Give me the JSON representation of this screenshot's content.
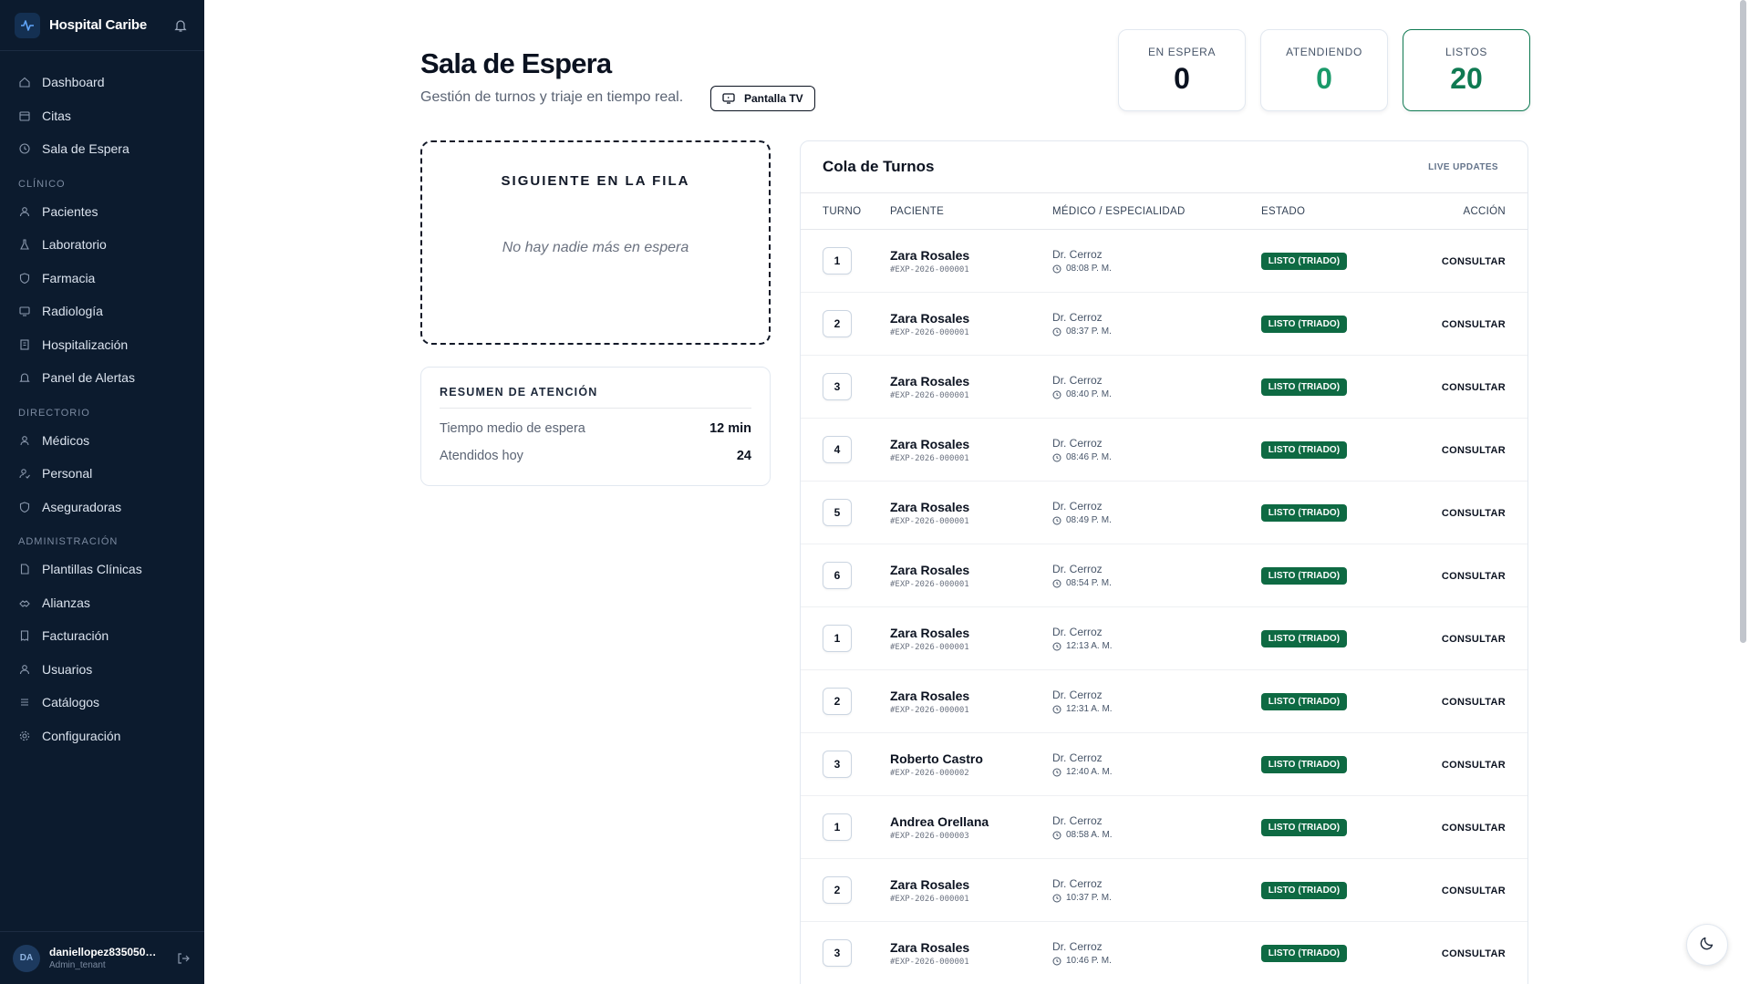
{
  "brand": {
    "name": "Hospital Caribe"
  },
  "nav": {
    "main": [
      {
        "label": "Dashboard",
        "icon": "home-icon"
      },
      {
        "label": "Citas",
        "icon": "calendar-icon"
      },
      {
        "label": "Sala de Espera",
        "icon": "clock-icon"
      }
    ],
    "sections": [
      {
        "title": "CLÍNICO",
        "items": [
          {
            "label": "Pacientes",
            "icon": "users-icon"
          },
          {
            "label": "Laboratorio",
            "icon": "flask-icon"
          },
          {
            "label": "Farmacia",
            "icon": "shield-icon"
          },
          {
            "label": "Radiología",
            "icon": "monitor-icon"
          },
          {
            "label": "Hospitalización",
            "icon": "building-icon"
          },
          {
            "label": "Panel de Alertas",
            "icon": "bell-icon"
          }
        ]
      },
      {
        "title": "DIRECTORIO",
        "items": [
          {
            "label": "Médicos",
            "icon": "user-icon"
          },
          {
            "label": "Personal",
            "icon": "user-check-icon"
          },
          {
            "label": "Aseguradoras",
            "icon": "shield-icon"
          }
        ]
      },
      {
        "title": "ADMINISTRACIÓN",
        "items": [
          {
            "label": "Plantillas Clínicas",
            "icon": "file-icon"
          },
          {
            "label": "Alianzas",
            "icon": "handshake-icon"
          },
          {
            "label": "Facturación",
            "icon": "receipt-icon"
          },
          {
            "label": "Usuarios",
            "icon": "users-icon"
          },
          {
            "label": "Catálogos",
            "icon": "list-icon"
          },
          {
            "label": "Configuración",
            "icon": "gear-icon"
          }
        ]
      }
    ]
  },
  "user": {
    "initials": "DA",
    "name": "daniellopez835050…",
    "role": "Admin_tenant"
  },
  "header": {
    "title": "Sala de Espera",
    "subtitle": "Gestión de turnos y triaje en tiempo real.",
    "tv_button": "Pantalla TV"
  },
  "stats": [
    {
      "label": "EN ESPERA",
      "value": "0",
      "color": "#0b1220"
    },
    {
      "label": "ATENDIENDO",
      "value": "0",
      "color": "#1a9a6a"
    },
    {
      "label": "LISTOS",
      "value": "20",
      "color": "#0f7a52"
    }
  ],
  "next": {
    "title": "SIGUIENTE EN LA FILA",
    "empty": "No hay nadie más en espera"
  },
  "summary": {
    "title": "RESUMEN DE ATENCIÓN",
    "rows": [
      {
        "label": "Tiempo medio de espera",
        "value": "12 min"
      },
      {
        "label": "Atendidos hoy",
        "value": "24"
      }
    ]
  },
  "queue": {
    "title": "Cola de Turnos",
    "live": "LIVE UPDATES",
    "columns": {
      "turno": "TURNO",
      "paciente": "PACIENTE",
      "medico": "MÉDICO / ESPECIALIDAD",
      "estado": "ESTADO",
      "accion": "ACCIÓN"
    },
    "rows": [
      {
        "turno": "1",
        "name": "Zara Rosales",
        "exp": "#EXP-2026-000001",
        "doctor": "Dr. Cerroz",
        "time": "08:08 P. M.",
        "status": "LISTO (TRIADO)",
        "action": "CONSULTAR"
      },
      {
        "turno": "2",
        "name": "Zara Rosales",
        "exp": "#EXP-2026-000001",
        "doctor": "Dr. Cerroz",
        "time": "08:37 P. M.",
        "status": "LISTO (TRIADO)",
        "action": "CONSULTAR"
      },
      {
        "turno": "3",
        "name": "Zara Rosales",
        "exp": "#EXP-2026-000001",
        "doctor": "Dr. Cerroz",
        "time": "08:40 P. M.",
        "status": "LISTO (TRIADO)",
        "action": "CONSULTAR"
      },
      {
        "turno": "4",
        "name": "Zara Rosales",
        "exp": "#EXP-2026-000001",
        "doctor": "Dr. Cerroz",
        "time": "08:46 P. M.",
        "status": "LISTO (TRIADO)",
        "action": "CONSULTAR"
      },
      {
        "turno": "5",
        "name": "Zara Rosales",
        "exp": "#EXP-2026-000001",
        "doctor": "Dr. Cerroz",
        "time": "08:49 P. M.",
        "status": "LISTO (TRIADO)",
        "action": "CONSULTAR"
      },
      {
        "turno": "6",
        "name": "Zara Rosales",
        "exp": "#EXP-2026-000001",
        "doctor": "Dr. Cerroz",
        "time": "08:54 P. M.",
        "status": "LISTO (TRIADO)",
        "action": "CONSULTAR"
      },
      {
        "turno": "1",
        "name": "Zara Rosales",
        "exp": "#EXP-2026-000001",
        "doctor": "Dr. Cerroz",
        "time": "12:13 A. M.",
        "status": "LISTO (TRIADO)",
        "action": "CONSULTAR"
      },
      {
        "turno": "2",
        "name": "Zara Rosales",
        "exp": "#EXP-2026-000001",
        "doctor": "Dr. Cerroz",
        "time": "12:31 A. M.",
        "status": "LISTO (TRIADO)",
        "action": "CONSULTAR"
      },
      {
        "turno": "3",
        "name": "Roberto Castro",
        "exp": "#EXP-2026-000002",
        "doctor": "Dr. Cerroz",
        "time": "12:40 A. M.",
        "status": "LISTO (TRIADO)",
        "action": "CONSULTAR"
      },
      {
        "turno": "1",
        "name": "Andrea Orellana",
        "exp": "#EXP-2026-000003",
        "doctor": "Dr. Cerroz",
        "time": "08:58 A. M.",
        "status": "LISTO (TRIADO)",
        "action": "CONSULTAR"
      },
      {
        "turno": "2",
        "name": "Zara Rosales",
        "exp": "#EXP-2026-000001",
        "doctor": "Dr. Cerroz",
        "time": "10:37 P. M.",
        "status": "LISTO (TRIADO)",
        "action": "CONSULTAR"
      },
      {
        "turno": "3",
        "name": "Zara Rosales",
        "exp": "#EXP-2026-000001",
        "doctor": "Dr. Cerroz",
        "time": "10:46 P. M.",
        "status": "LISTO (TRIADO)",
        "action": "CONSULTAR"
      }
    ]
  }
}
